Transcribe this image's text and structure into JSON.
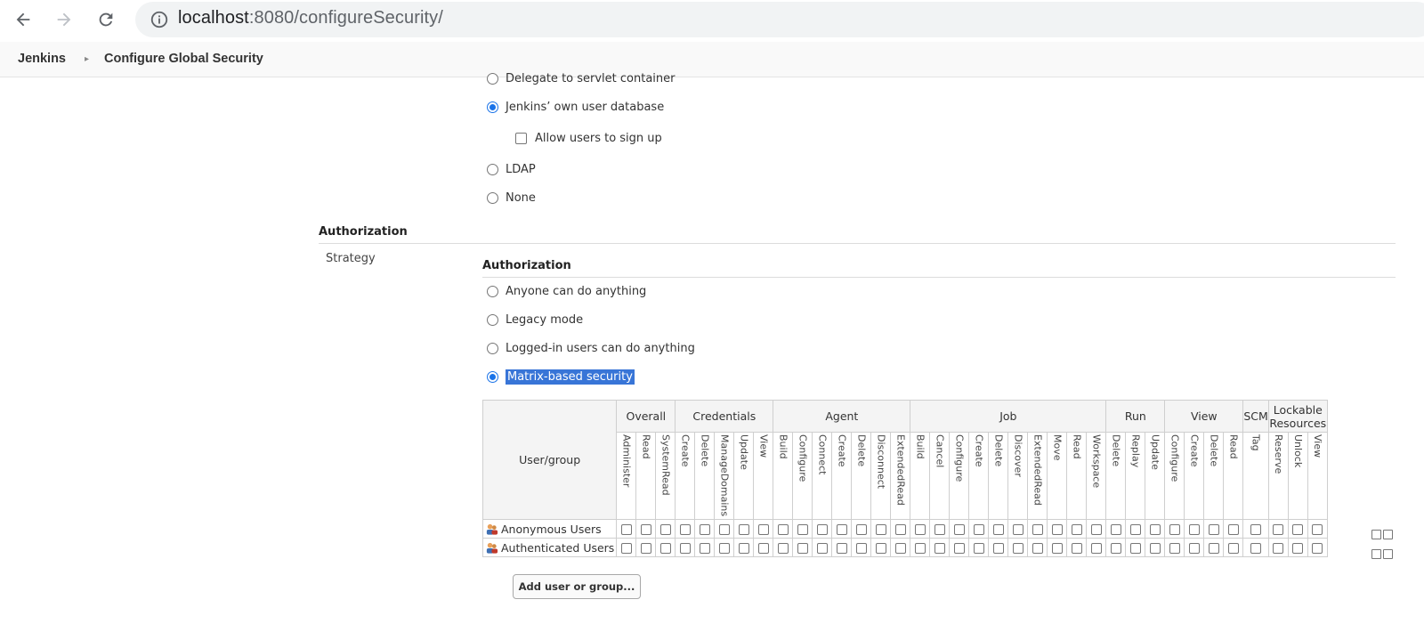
{
  "browser": {
    "url_host": "localhost",
    "url_rest": ":8080/configureSecurity/",
    "icons": [
      "back-arrow-icon",
      "forward-arrow-icon",
      "reload-icon",
      "info-icon"
    ]
  },
  "breadcrumb": {
    "home": "Jenkins",
    "current": "Configure Global Security"
  },
  "security_realm": {
    "options": [
      {
        "label": "Delegate to servlet container",
        "checked": false
      },
      {
        "label": "Jenkins’ own user database",
        "checked": true
      },
      {
        "label": "LDAP",
        "checked": false
      },
      {
        "label": "None",
        "checked": false
      }
    ],
    "allow_signup_label": "Allow users to sign up",
    "allow_signup_checked": false
  },
  "authorization": {
    "section_title": "Authorization",
    "strategy_label": "Strategy",
    "subsection_title": "Authorization",
    "options": [
      {
        "label": "Anyone can do anything",
        "checked": false
      },
      {
        "label": "Legacy mode",
        "checked": false
      },
      {
        "label": "Logged-in users can do anything",
        "checked": false
      },
      {
        "label": "Matrix-based security",
        "checked": true
      }
    ]
  },
  "matrix": {
    "user_group_header": "User/group",
    "groups": [
      {
        "name": "Overall",
        "permissions": [
          "Administer",
          "Read",
          "SystemRead"
        ]
      },
      {
        "name": "Credentials",
        "permissions": [
          "Create",
          "Delete",
          "ManageDomains",
          "Update",
          "View"
        ]
      },
      {
        "name": "Agent",
        "permissions": [
          "Build",
          "Configure",
          "Connect",
          "Create",
          "Delete",
          "Disconnect",
          "ExtendedRead"
        ]
      },
      {
        "name": "Job",
        "permissions": [
          "Build",
          "Cancel",
          "Configure",
          "Create",
          "Delete",
          "Discover",
          "ExtendedRead",
          "Move",
          "Read",
          "Workspace"
        ]
      },
      {
        "name": "Run",
        "permissions": [
          "Delete",
          "Replay",
          "Update"
        ]
      },
      {
        "name": "View",
        "permissions": [
          "Configure",
          "Create",
          "Delete",
          "Read"
        ]
      },
      {
        "name": "SCM",
        "permissions": [
          "Tag"
        ]
      },
      {
        "name": "Lockable Resources",
        "permissions": [
          "Reserve",
          "Unlock",
          "View"
        ]
      }
    ],
    "rows": [
      {
        "name": "Anonymous Users"
      },
      {
        "name": "Authenticated Users"
      }
    ]
  },
  "add_button_label": "Add user or group..."
}
